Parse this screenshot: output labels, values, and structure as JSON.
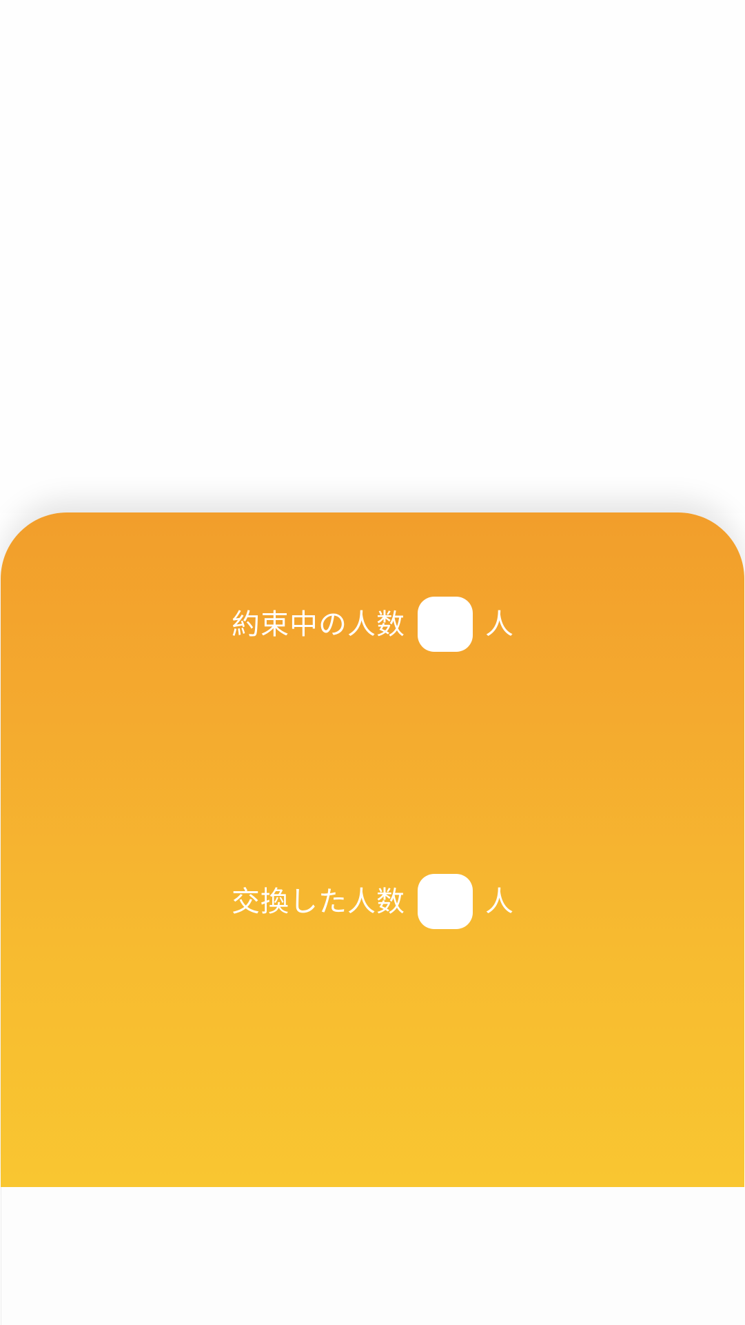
{
  "stats": {
    "promised": {
      "label": "約束中の人数",
      "count": "",
      "unit": "人"
    },
    "exchanged": {
      "label": "交換した人数",
      "count": "",
      "unit": "人"
    }
  },
  "colors": {
    "card_gradient_top": "#f29e2b",
    "card_gradient_bottom": "#f9c631",
    "text": "#ffffff",
    "count_box": "#ffffff"
  }
}
